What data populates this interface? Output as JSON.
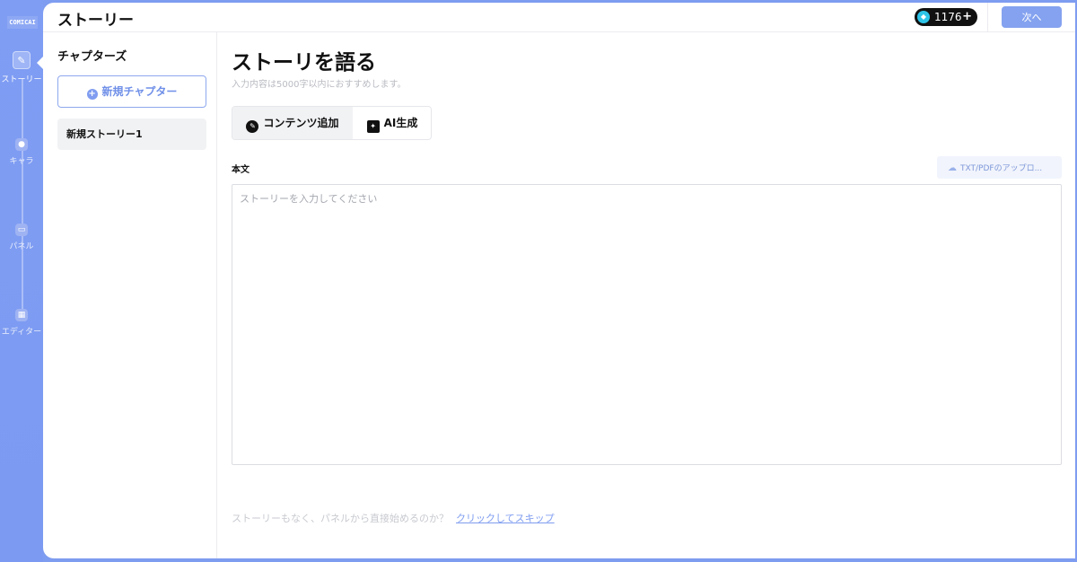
{
  "rail": {
    "logo": "COMICAI",
    "steps": [
      {
        "label": "ストーリー",
        "icon": "pencil-icon"
      },
      {
        "label": "キャラ",
        "icon": "person-icon"
      },
      {
        "label": "パネル",
        "icon": "panel-icon"
      },
      {
        "label": "エディター",
        "icon": "editor-icon"
      }
    ]
  },
  "header": {
    "title": "ストーリー",
    "tokens": "1176",
    "token_plus": "+",
    "next_label": "次へ"
  },
  "chapters": {
    "title": "チャプターズ",
    "new_chapter_label": "新規チャプター",
    "items": [
      "新規ストーリー1"
    ]
  },
  "main": {
    "heading": "ストーリを語る",
    "hint": "入力内容は5000字以内におすすめします。",
    "tabs": [
      {
        "label": "コンテンツ追加",
        "icon": "add-content-icon"
      },
      {
        "label": "AI生成",
        "icon": "ai-icon"
      }
    ],
    "body_label": "本文",
    "upload_label": "TXT/PDFのアップロ...",
    "textarea_placeholder": "ストーリーを入力してください",
    "skip_text": "ストーリーもなく、パネルから直接始めるのか？",
    "skip_link": "クリックしてスキップ"
  },
  "colors": {
    "accent": "#7e9cf0",
    "button": "#84a2ef",
    "link": "#7f9df0"
  }
}
